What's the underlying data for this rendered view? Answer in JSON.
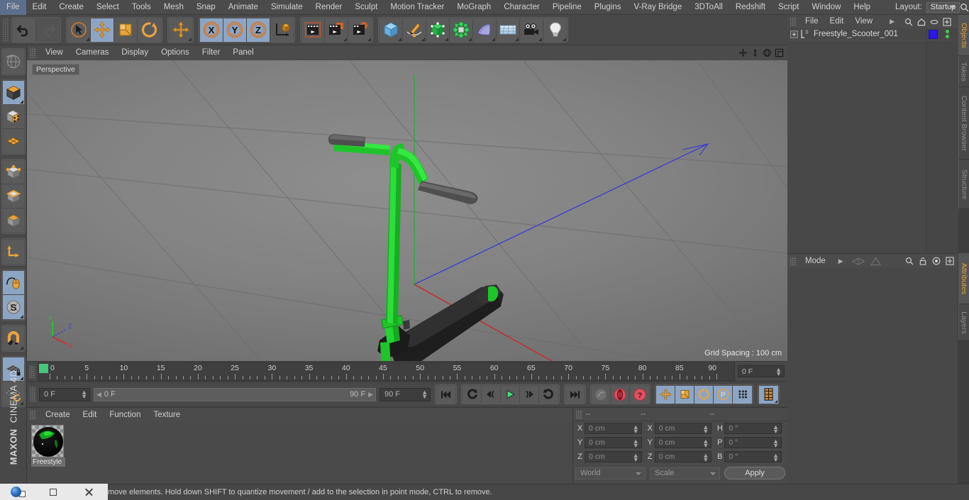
{
  "app": {
    "brand_line1": "MAXON",
    "brand_line2": "CINEMA 4D"
  },
  "menubar": {
    "items": [
      "File",
      "Edit",
      "Create",
      "Select",
      "Tools",
      "Mesh",
      "Snap",
      "Animate",
      "Simulate",
      "Render",
      "Sculpt",
      "Motion Tracker",
      "MoGraph",
      "Character",
      "Pipeline",
      "Plugins",
      "V-Ray Bridge",
      "3DToAll",
      "Redshift",
      "Script",
      "Window",
      "Help"
    ],
    "layout_label": "Layout:",
    "layout_value": "Startup",
    "search_icon": "search-icon"
  },
  "toolbar": {
    "undo": "undo-icon",
    "redo": "redo-icon",
    "select": "live-selection-icon",
    "move": "move-tool-icon",
    "scale": "scale-tool-icon",
    "rotate": "rotate-tool-icon",
    "move_alt": "move-axis-icon",
    "axis_x": "X",
    "axis_y": "Y",
    "axis_z": "Z",
    "world_object_axis": "world-object-axis-icon",
    "render_view": "render-view-icon",
    "render_region": "render-region-icon",
    "render_settings": "render-settings-icon",
    "cube": "primitive-cube-icon",
    "spline": "spline-pen-icon",
    "generator": "generator-icon",
    "deformer": "deformer-icon",
    "scene": "scene-object-icon",
    "floor": "environment-floor-icon",
    "camera": "camera-icon",
    "light": "light-icon"
  },
  "left_toolbar": {
    "items": [
      {
        "name": "undo-view-icon",
        "active": false
      },
      {
        "name": "editable-object-icon",
        "active": true
      },
      {
        "name": "model-mode-icon",
        "active": false
      },
      {
        "name": "texture-mode-icon",
        "active": false
      },
      {
        "name": "points-mode-icon",
        "active": false
      },
      {
        "name": "edges-mode-icon",
        "active": false
      },
      {
        "name": "polygons-mode-icon",
        "active": false
      },
      {
        "name": "object-axis-icon",
        "active": false
      },
      {
        "name": "viewport-solo-icon",
        "active": true
      },
      {
        "name": "enable-snap-icon",
        "active": true
      },
      {
        "name": "magnet-icon",
        "active": false
      },
      {
        "name": "workplane-lock-icon",
        "active": true
      },
      {
        "name": "workplane-rotate-icon",
        "active": false
      }
    ]
  },
  "viewport": {
    "menu": [
      "View",
      "Cameras",
      "Display",
      "Options",
      "Filter",
      "Panel"
    ],
    "label": "Perspective",
    "grid_spacing": "Grid Spacing : 100 cm",
    "corner_icons": [
      "pan-view-icon",
      "dolly-view-icon",
      "rotate-view-icon",
      "maximize-view-icon"
    ],
    "axis_labels": {
      "x": "X",
      "y": "Y",
      "z": "Z"
    },
    "colors": {
      "scooter_green": "#1fc42a",
      "scooter_dark": "#2b2b2b",
      "grip_gray": "#5a5a5a",
      "x_axis": "#c23b3b",
      "y_axis": "#3fbe3f",
      "z_axis": "#3b48c2",
      "background_light": "#8e8e8e",
      "background_dark": "#555555"
    }
  },
  "timeline": {
    "ticks": [
      0,
      5,
      10,
      15,
      20,
      25,
      30,
      35,
      40,
      45,
      50,
      55,
      60,
      65,
      70,
      75,
      80,
      85,
      90
    ],
    "current_frame_field": "0 F",
    "playhead_frame": 0
  },
  "playback": {
    "current_frame": "0 F",
    "range_start": "0 F",
    "range_end": "90 F",
    "end_frame": "90 F",
    "buttons": [
      {
        "name": "go-to-start-button",
        "icon": "skip-start"
      },
      {
        "name": "play-backwards-button",
        "icon": "play-back"
      },
      {
        "name": "previous-frame-button",
        "icon": "step-back"
      },
      {
        "name": "play-forward-button",
        "icon": "play"
      },
      {
        "name": "next-frame-button",
        "icon": "step-forward"
      },
      {
        "name": "play-loop-button",
        "icon": "loop"
      },
      {
        "name": "go-to-end-button",
        "icon": "skip-end"
      },
      {
        "name": "record-active-objects-button",
        "icon": "record-disabled"
      },
      {
        "name": "autokeying-button",
        "icon": "autokey"
      },
      {
        "name": "keyframe-selection-button",
        "icon": "question"
      },
      {
        "name": "position-key-button",
        "icon": "move-key"
      },
      {
        "name": "scale-key-button",
        "icon": "scale-key"
      },
      {
        "name": "rotation-key-button",
        "icon": "rotate-key"
      },
      {
        "name": "parameter-key-button",
        "icon": "param-key"
      },
      {
        "name": "point-level-animation-button",
        "icon": "pla"
      },
      {
        "name": "timeline-button",
        "icon": "timeline"
      }
    ]
  },
  "material_manager": {
    "menu": [
      "Create",
      "Edit",
      "Function",
      "Texture"
    ],
    "materials": [
      {
        "name": "Freestyle",
        "color": "#0aa81a"
      }
    ]
  },
  "coordinates": {
    "headers": [
      "--",
      "--",
      "--"
    ],
    "rows": [
      {
        "label_pos": "X",
        "pos": "0 cm",
        "label_size": "X",
        "size": "0 cm",
        "label_rot": "H",
        "rot": "0 °"
      },
      {
        "label_pos": "Y",
        "pos": "0 cm",
        "label_size": "Y",
        "size": "0 cm",
        "label_rot": "P",
        "rot": "0 °"
      },
      {
        "label_pos": "Z",
        "pos": "0 cm",
        "label_size": "Z",
        "size": "0 cm",
        "label_rot": "B",
        "rot": "0 °"
      }
    ],
    "coord_system": "World",
    "transform_mode": "Scale",
    "apply_label": "Apply"
  },
  "object_manager": {
    "menu": [
      "File",
      "Edit",
      "View"
    ],
    "overflow_icon": "chevron-right-icon",
    "icons": [
      "search-icon",
      "home-icon",
      "ellipse-icon",
      "add-icon"
    ],
    "objects": [
      {
        "name": "Freestyle_Scooter_001",
        "tag_color": "#2a19e8",
        "type_icon": "null-object-icon"
      }
    ]
  },
  "attributes": {
    "mode_label": "Mode",
    "arrow": "chevron-right-icon",
    "nav_icons": [
      "prev-object-icon",
      "up-object-icon"
    ],
    "tool_icons": [
      "search-icon",
      "lock-icon",
      "target-icon",
      "add-icon"
    ]
  },
  "vertical_tabs_top": [
    "Objects",
    "Takes",
    "Content Browser",
    "Structure"
  ],
  "vertical_tabs_bottom": [
    "Attributes",
    "Layers"
  ],
  "statusbar": {
    "message": "move elements. Hold down SHIFT to quantize movement / add to the selection in point mode, CTRL to remove."
  },
  "taskbar": {
    "items": [
      "c4d-app-icon",
      "restore-window-icon",
      "close-window-icon"
    ]
  }
}
